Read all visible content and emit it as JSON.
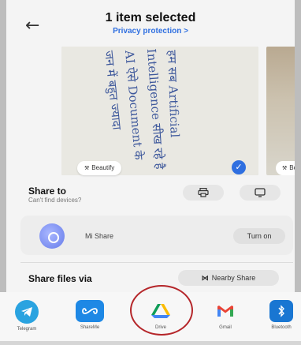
{
  "header": {
    "title": "1 item selected",
    "subtitle": "Privacy protection >"
  },
  "photos": {
    "beautify_label": "Beautify",
    "side_label": "Bo",
    "handwriting_lines": [
      "हम सब Artificial",
      "Intelligence सीख रहे है",
      "AI ऐसे Document के",
      "जन में बहुत ज्यादा"
    ]
  },
  "share_to": {
    "title": "Share to",
    "subtitle": "Can't find devices?"
  },
  "mi_share": {
    "label": "Mi Share",
    "button": "Turn on"
  },
  "share_files": {
    "title": "Share files via",
    "nearby_label": "Nearby Share"
  },
  "apps": [
    {
      "label": "Telegram",
      "icon": "telegram-icon",
      "color": "#2aa3e0"
    },
    {
      "label": "ShareMe",
      "icon": "shareme-icon",
      "color": "#1e88e5"
    },
    {
      "label": "Drive",
      "icon": "drive-icon",
      "color": "#ffffff"
    },
    {
      "label": "Gmail",
      "icon": "gmail-icon",
      "color": "#ffffff"
    },
    {
      "label": "Bluetooth",
      "icon": "bluetooth-icon",
      "color": "#1976d2"
    }
  ],
  "colors": {
    "accent": "#2f6fe0",
    "highlight_circle": "#b5262a"
  }
}
